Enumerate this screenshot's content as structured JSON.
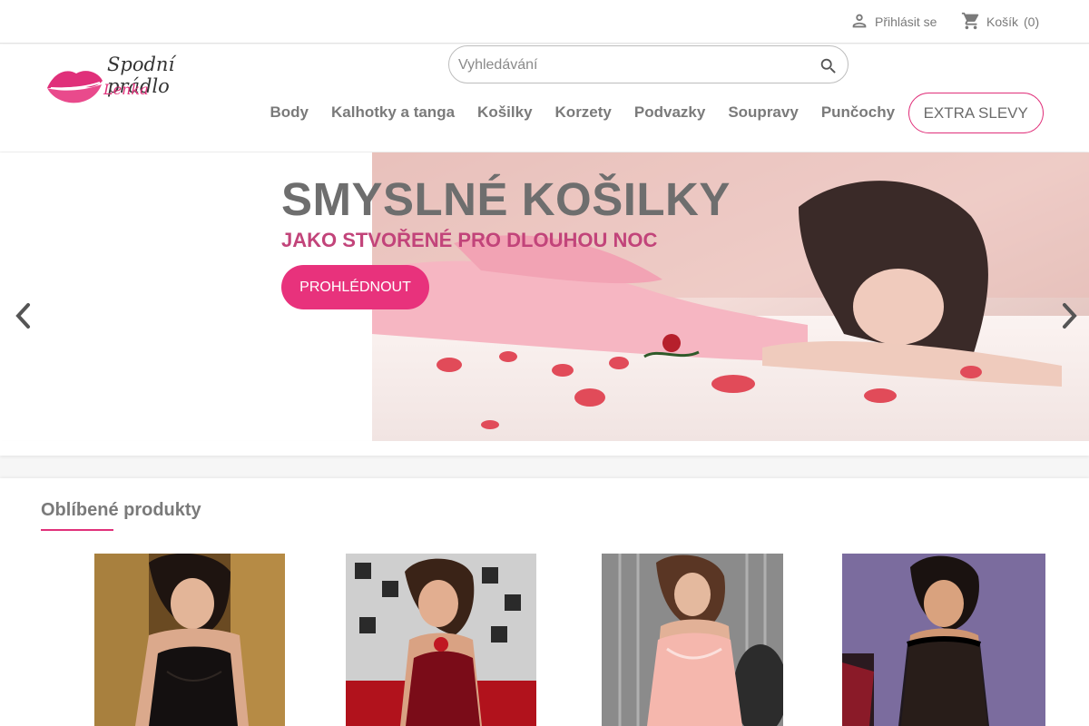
{
  "topbar": {
    "signin_label": "Přihlásit se",
    "cart_label": "Košík",
    "cart_count": "(0)"
  },
  "header": {
    "logo_line1": "Spodní prádlo",
    "logo_line2": "Lenka",
    "search_placeholder": "Vyhledávání"
  },
  "nav": {
    "items": [
      {
        "label": "Body"
      },
      {
        "label": "Kalhotky a tanga"
      },
      {
        "label": "Košilky"
      },
      {
        "label": "Korzety"
      },
      {
        "label": "Podvazky"
      },
      {
        "label": "Soupravy"
      },
      {
        "label": "Punčochy"
      }
    ],
    "extra_label": "EXTRA SLEVY"
  },
  "slider": {
    "title": "SMYSLNÉ KOŠILKY",
    "subtitle": "JAKO STVOŘENÉ PRO DLOUHOU NOC",
    "button_label": "PROHLÉDNOUT"
  },
  "featured": {
    "title": "Oblíbené produkty"
  },
  "colors": {
    "accent": "#e8327c",
    "subtitle": "#c2447a",
    "text": "#7a7a7a"
  }
}
